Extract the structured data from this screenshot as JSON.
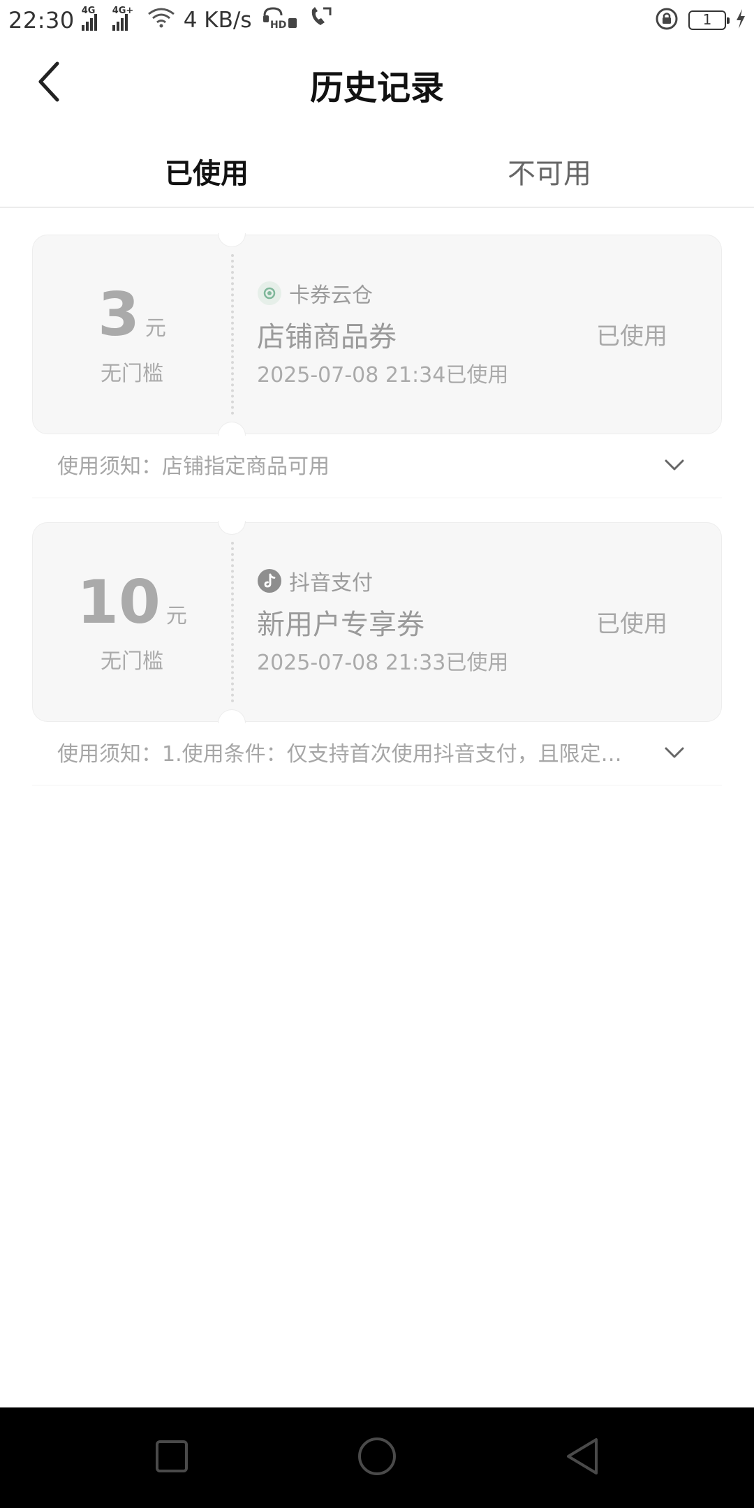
{
  "status_bar": {
    "time": "22:30",
    "signal1_tag": "4G",
    "signal2_tag": "4G+",
    "net_speed": "4 KB/s",
    "hd_badge": "HD",
    "battery_level": "1"
  },
  "header": {
    "title": "历史记录",
    "back_icon": "chevron-left-icon"
  },
  "tabs": [
    {
      "label": "已使用",
      "active": true
    },
    {
      "label": "不可用",
      "active": false
    }
  ],
  "coupons": [
    {
      "amount": "3",
      "unit": "元",
      "threshold": "无门槛",
      "brand_icon": "cloud-swirl-icon",
      "brand": "卡券云仓",
      "name": "店铺商品券",
      "used_time": "2025-07-08 21:34已使用",
      "status": "已使用",
      "notice": "使用须知：店铺指定商品可用"
    },
    {
      "amount": "10",
      "unit": "元",
      "threshold": "无门槛",
      "brand_icon": "tiktok-icon",
      "brand": "抖音支付",
      "name": "新用户专享券",
      "used_time": "2025-07-08 21:33已使用",
      "status": "已使用",
      "notice": "使用须知：1.使用条件：仅支持首次使用抖音支付，且限定…"
    }
  ],
  "nav_bar": {
    "recent_icon": "square-icon",
    "home_icon": "circle-icon",
    "back_icon": "triangle-back-icon"
  }
}
